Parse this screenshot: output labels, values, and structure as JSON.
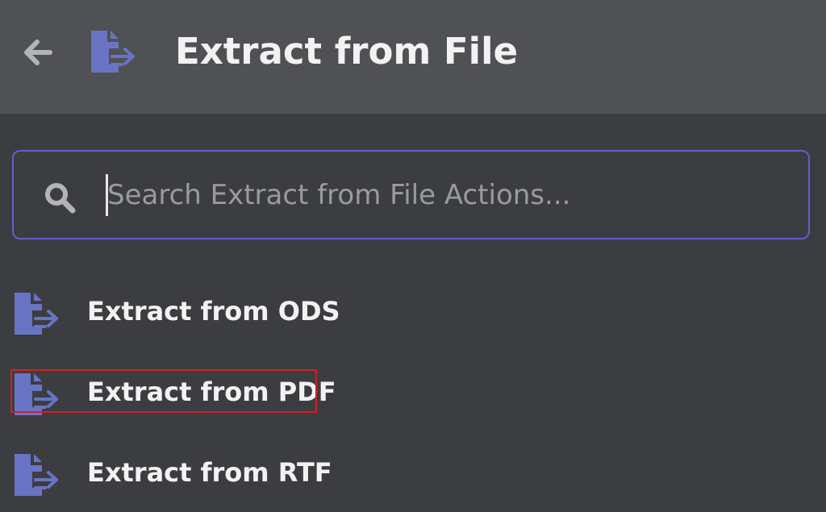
{
  "header": {
    "back_icon": "arrow-left-icon",
    "file_icon": "file-export-icon",
    "title": "Extract from File"
  },
  "search": {
    "icon": "search-icon",
    "placeholder": "Search Extract from File Actions...",
    "value": ""
  },
  "items": [
    {
      "label": "Extract from ODS",
      "icon": "file-export-icon"
    },
    {
      "label": "Extract from PDF",
      "icon": "file-export-icon",
      "highlighted": true
    },
    {
      "label": "Extract from RTF",
      "icon": "file-export-icon"
    }
  ],
  "colors": {
    "accent_icon": "#6a74c4",
    "search_border": "#6a5acd",
    "highlight_border": "#d0202a",
    "header_bg": "#505154",
    "panel_bg": "#3c3d40"
  }
}
